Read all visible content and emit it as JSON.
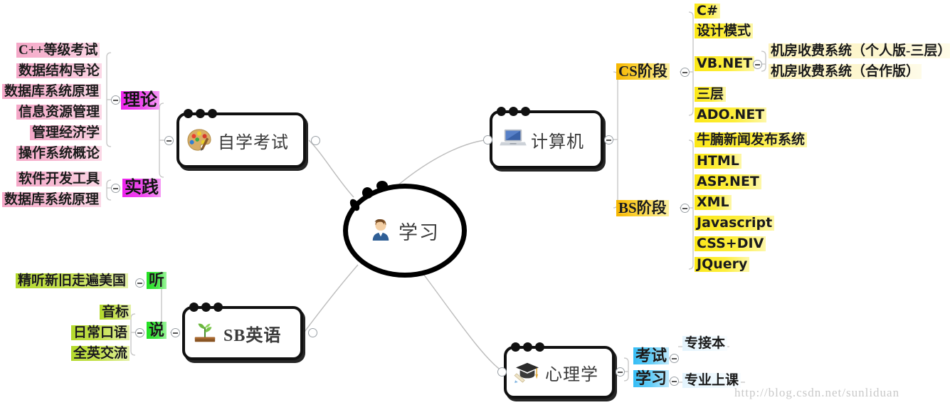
{
  "watermark": "http://blog.csdn.net/sunliduan",
  "central": {
    "label": "学习",
    "icon": "person-avatar-icon"
  },
  "branches": [
    {
      "id": "zixue",
      "label": "自学考试",
      "icon": "artist-palette-icon"
    },
    {
      "id": "jisuanji",
      "label": "计算机",
      "icon": "laptop-icon"
    },
    {
      "id": "sbyingyu",
      "label": "SB英语",
      "icon": "seedling-icon"
    },
    {
      "id": "xinlixue",
      "label": "心理学",
      "icon": "graduation-cap-icon"
    }
  ],
  "zixue": {
    "groups": [
      {
        "label": "理论",
        "items": [
          "C++等级考试",
          "数据结构导论",
          "数据库系统原理",
          "信息资源管理",
          "管理经济学",
          "操作系统概论"
        ]
      },
      {
        "label": "实践",
        "items": [
          "软件开发工具",
          "数据库系统原理"
        ]
      }
    ]
  },
  "jisuanji": {
    "groups": [
      {
        "label": "CS阶段",
        "items": [
          "C#",
          "设计模式",
          "VB.NET",
          "三层",
          "ADO.NET"
        ],
        "sub": {
          "parent": "VB.NET",
          "items": [
            "机房收费系统（个人版-三层）",
            "机房收费系统（合作版）"
          ]
        }
      },
      {
        "label": "BS阶段",
        "items": [
          "牛腩新闻发布系统",
          "HTML",
          "ASP.NET",
          "XML",
          "Javascript",
          "CSS+DIV",
          "JQuery"
        ]
      }
    ]
  },
  "sbyingyu": {
    "groups": [
      {
        "label": "听",
        "items": [
          "精听新旧走遍美国"
        ]
      },
      {
        "label": "说",
        "items": [
          "音标",
          "日常口语",
          "全英交流"
        ]
      }
    ]
  },
  "xinlixue": {
    "groups": [
      {
        "label": "考试",
        "items": [
          "专接本"
        ]
      },
      {
        "label": "学习",
        "items": [
          "专业上课"
        ]
      }
    ]
  },
  "colors": {
    "pink": "#f5a8c8",
    "magenta": "#ee22ee",
    "yellow": "#fbe716",
    "gold": "#f6b600",
    "yellow_green": "#b3d92a",
    "green": "#22e022",
    "cyan": "#35bdf5",
    "node_border": "#111111",
    "wire": "#b9b9b9"
  }
}
